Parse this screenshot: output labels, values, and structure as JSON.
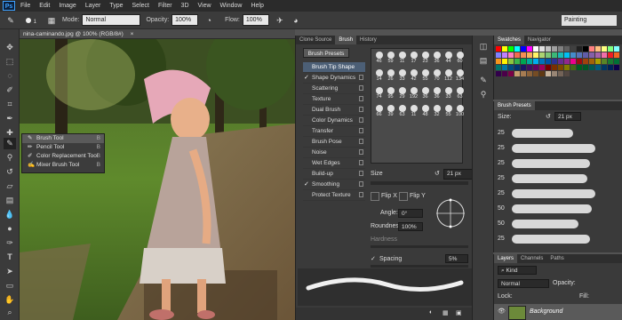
{
  "menubar": {
    "logo": "Ps",
    "items": [
      "File",
      "Edit",
      "Image",
      "Layer",
      "Type",
      "Select",
      "Filter",
      "3D",
      "View",
      "Window",
      "Help"
    ]
  },
  "options": {
    "size": "1",
    "mode_label": "Mode:",
    "mode_value": "Normal",
    "opacity_label": "Opacity:",
    "opacity_value": "100%",
    "flow_label": "Flow:",
    "flow_value": "100%",
    "workspace": "Painting"
  },
  "document": {
    "tab_title": "nina-caminando.jpg @ 100% (RGB/8#)"
  },
  "tool_flyout": {
    "items": [
      {
        "label": "Brush Tool",
        "key": "B"
      },
      {
        "label": "Pencil Tool",
        "key": "B"
      },
      {
        "label": "Color Replacement Tool",
        "key": "B"
      },
      {
        "label": "Mixer Brush Tool",
        "key": "B"
      }
    ]
  },
  "brush_panel": {
    "tabs": [
      "Clone Source",
      "Brush",
      "History"
    ],
    "presets_button": "Brush Presets",
    "settings": [
      {
        "label": "Brush Tip Shape",
        "checked": false,
        "selected": true
      },
      {
        "label": "Shape Dynamics",
        "checked": true
      },
      {
        "label": "Scattering",
        "checked": false
      },
      {
        "label": "Texture",
        "checked": false
      },
      {
        "label": "Dual Brush",
        "checked": false
      },
      {
        "label": "Color Dynamics",
        "checked": false
      },
      {
        "label": "Transfer",
        "checked": false
      },
      {
        "label": "Brush Pose",
        "checked": false
      },
      {
        "label": "Noise",
        "checked": false
      },
      {
        "label": "Wet Edges",
        "checked": false
      },
      {
        "label": "Build-up",
        "checked": false
      },
      {
        "label": "Smoothing",
        "checked": true
      },
      {
        "label": "Protect Texture",
        "checked": false
      }
    ],
    "tip_sizes": [
      "46",
      "59",
      "11",
      "17",
      "23",
      "36",
      "44",
      "60",
      "14",
      "26",
      "33",
      "42",
      "55",
      "70",
      "112",
      "134",
      "74",
      "95",
      "29",
      "192",
      "36",
      "36",
      "33",
      "63",
      "66",
      "39",
      "63",
      "11",
      "48",
      "32",
      "55",
      "100"
    ],
    "size_label": "Size",
    "size_value": "21 px",
    "flip_x": "Flip X",
    "flip_y": "Flip Y",
    "angle_label": "Angle:",
    "angle_value": "0°",
    "roundness_label": "Roundness:",
    "roundness_value": "100%",
    "hardness_label": "Hardness",
    "spacing_label": "Spacing",
    "spacing_value": "5%"
  },
  "swatches_panel": {
    "tabs": [
      "Swatches",
      "Navigator"
    ],
    "colors": [
      "#ff0000",
      "#ffff00",
      "#00ff00",
      "#00ffff",
      "#0000ff",
      "#ff00ff",
      "#ffffff",
      "#e0e0e0",
      "#c0c0c0",
      "#a0a0a0",
      "#808080",
      "#606060",
      "#404040",
      "#202020",
      "#000000",
      "#ff8080",
      "#ffc080",
      "#ffff80",
      "#80ff80",
      "#80ffff",
      "#8080ff",
      "#c080ff",
      "#ff80c0",
      "#f26c4f",
      "#f68e55",
      "#fbaf5c",
      "#fff467",
      "#acd372",
      "#7cc576",
      "#3bb878",
      "#1abbb4",
      "#00bff3",
      "#438ccb",
      "#5574b9",
      "#605ca8",
      "#855fa8",
      "#a763a8",
      "#f06ea9",
      "#ed1c24",
      "#f26522",
      "#f7941d",
      "#fff200",
      "#8dc63f",
      "#39b54a",
      "#00a651",
      "#00a99d",
      "#00aeef",
      "#0072bc",
      "#0054a6",
      "#2e3192",
      "#662d91",
      "#92278f",
      "#ec008c",
      "#9e0b0f",
      "#a0410d",
      "#a36209",
      "#aba000",
      "#598527",
      "#1a7b30",
      "#007236",
      "#00746b",
      "#0076a3",
      "#004b80",
      "#003471",
      "#1b1464",
      "#440e62",
      "#630460",
      "#9e005d",
      "#790000",
      "#7b2e00",
      "#7d4900",
      "#827b00",
      "#406618",
      "#005e20",
      "#005826",
      "#005952",
      "#005b7f",
      "#003663",
      "#002157",
      "#0d004c",
      "#32004b",
      "#4b0049",
      "#7b0046",
      "#c69c6d",
      "#a67c52",
      "#8c6239",
      "#754c24",
      "#603913",
      "#c7b299",
      "#998675",
      "#736357",
      "#534741"
    ]
  },
  "brush_presets_panel": {
    "title": "Brush Presets",
    "size_label": "Size:",
    "size_value": "21 px",
    "items": [
      {
        "size": "25",
        "stroke": 0.55
      },
      {
        "size": "25",
        "stroke": 0.75
      },
      {
        "size": "25",
        "stroke": 0.7
      },
      {
        "size": "25",
        "stroke": 0.68
      },
      {
        "size": "25",
        "stroke": 0.75
      },
      {
        "size": "50",
        "stroke": 0.72
      },
      {
        "size": "50",
        "stroke": 0.6
      },
      {
        "size": "25",
        "stroke": 0.7
      }
    ]
  },
  "layers_panel": {
    "tabs": [
      "Layers",
      "Channels",
      "Paths"
    ],
    "kind_label": "Kind",
    "blend_mode": "Normal",
    "opacity_label": "Opacity:",
    "lock_label": "Lock:",
    "fill_label": "Fill:",
    "layer_name": "Background"
  }
}
